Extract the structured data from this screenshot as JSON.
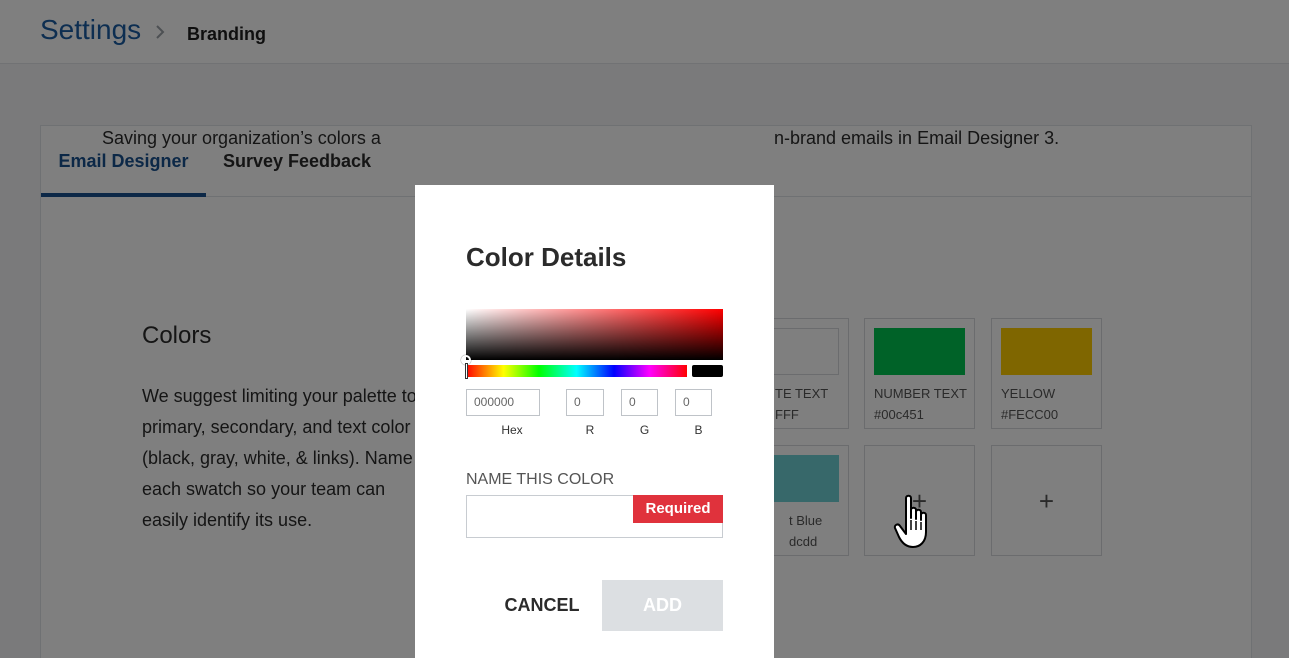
{
  "breadcrumb": {
    "root": "Settings",
    "current": "Branding"
  },
  "tabs": [
    {
      "label": "Email Designer",
      "active": true
    },
    {
      "label": "Survey Feedback",
      "active": false
    }
  ],
  "content": {
    "intro_left": "Saving your organization’s colors a",
    "intro_right": "n-brand emails in Email Designer 3.",
    "colors_heading": "Colors",
    "suggest_lines": [
      "We suggest limiting your palette to",
      "primary, secondary, and text color",
      "(black, gray, white, & links). Name",
      "each swatch so your team can",
      "easily identify its use."
    ]
  },
  "swatches": [
    {
      "name": "TE TEXT",
      "hex": "FFF",
      "color": "#FFFFFF"
    },
    {
      "name": "NUMBER TEXT",
      "hex": "#00c451",
      "color": "#00c451"
    },
    {
      "name": "YELLOW",
      "hex": "#FECC00",
      "color": "#FECC00"
    },
    {
      "name": "t Blue",
      "hex": "dcdd",
      "color": "#6fd0d5"
    }
  ],
  "add_symbol": "+",
  "modal": {
    "title": "Color Details",
    "hex_value": "000000",
    "r_value": "0",
    "g_value": "0",
    "b_value": "0",
    "hex_label": "Hex",
    "r_label": "R",
    "g_label": "G",
    "b_label": "B",
    "name_label": "NAME THIS COLOR",
    "name_value": "",
    "required_badge": "Required",
    "cancel_label": "CANCEL",
    "add_label": "ADD",
    "preview_color": "#000000"
  }
}
